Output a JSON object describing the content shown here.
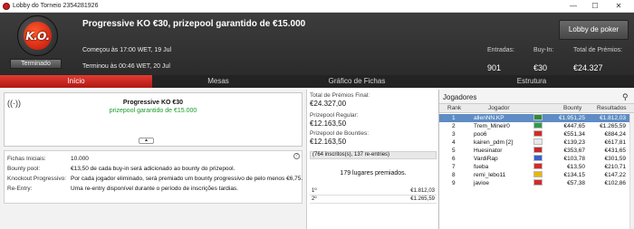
{
  "window": {
    "title": "Lobby do Torneio 2354281926",
    "minimize": "—",
    "maximize": "☐",
    "close": "✕"
  },
  "header": {
    "logo_text": "K.O.",
    "status_badge": "Terminado",
    "title": "Progressive KO €30, prizepool garantido de €15.000",
    "start": "Começou às 17:00 WET, 19 Jul",
    "end": "Terminou às 00:46 WET, 20 Jul",
    "stats": [
      {
        "label": "Entradas:",
        "value": "901"
      },
      {
        "label": "Buy-In:",
        "value": "€30"
      },
      {
        "label": "Total de Prémios:",
        "value": "€24.327"
      }
    ],
    "lobby_button": "Lobby de poker"
  },
  "tabs": [
    "Início",
    "Mesas",
    "Gráfico de Fichas",
    "Estrutura"
  ],
  "tournament_info": {
    "signal_icon": "((·))",
    "name": "Progressive KO €30",
    "guarantee": "prizepool garantido de €15.000",
    "collapse_icon": "▲"
  },
  "details": [
    {
      "label": "Fichas Iniciais:",
      "value": "10.000"
    },
    {
      "label": "Bounty pool:",
      "value": "€13,50 de cada buy-in será adicionado ao bounty do prizepool."
    },
    {
      "label": "Knockout Progressivo:",
      "value": "Por cada jogador eliminado, será premiado um bounty progressivo de pelo menos €6,75."
    },
    {
      "label": "Re-Entry:",
      "value": "Uma re-entry disponível durante o período de inscrições tardias."
    }
  ],
  "details_help_icon": "?",
  "prize": {
    "total_label": "Total de Prémios Final:",
    "total_value": "€24.327,00",
    "regular_label": "Prizepool Regular:",
    "regular_value": "€12.163,50",
    "bounties_label": "Prizepool de Bounties:",
    "bounties_value": "€12.163,50",
    "entrants": "(764 inscritos(s), 137 re-entries)",
    "places": "179 lugares premiados.",
    "payouts": [
      {
        "place": "1º",
        "amount": "€1.812,03"
      },
      {
        "place": "2º",
        "amount": "€1.265,59"
      }
    ]
  },
  "players": {
    "header": "Jogadores",
    "search_icon": "⚲",
    "columns": [
      "Rank",
      "Jogador",
      "Bounty",
      "Resultados"
    ],
    "rows": [
      {
        "rank": "1",
        "name": "allenNN.KP",
        "bounty": "€1.951,25",
        "result": "€1.812,03",
        "flag": "#2e8b3a"
      },
      {
        "rank": "2",
        "name": "Trem_Mineir0",
        "bounty": "€447,65",
        "result": "€1.265,59",
        "flag": "#2e9b4a"
      },
      {
        "rank": "3",
        "name": "poo6",
        "bounty": "€551,34",
        "result": "€884,24",
        "flag": "#d62828"
      },
      {
        "rank": "4",
        "name": "kairen_pdm [2]",
        "bounty": "€139,23",
        "result": "€617,81",
        "flag": "#e8e8e8"
      },
      {
        "rank": "5",
        "name": "Huesinator",
        "bounty": "€353,67",
        "result": "€431,65",
        "flag": "#c62828"
      },
      {
        "rank": "6",
        "name": "VardiRap",
        "bounty": "€103,78",
        "result": "€301,59",
        "flag": "#3a5fcd"
      },
      {
        "rank": "7",
        "name": "fueba",
        "bounty": "€13,50",
        "result": "€210,71",
        "flag": "#d22a2a"
      },
      {
        "rank": "8",
        "name": "remi_lebo11",
        "bounty": "€134,15",
        "result": "€147,22",
        "flag": "#e6b800"
      },
      {
        "rank": "9",
        "name": "javioe",
        "bounty": "€57,38",
        "result": "€102,86",
        "flag": "#d22a2a"
      }
    ]
  }
}
